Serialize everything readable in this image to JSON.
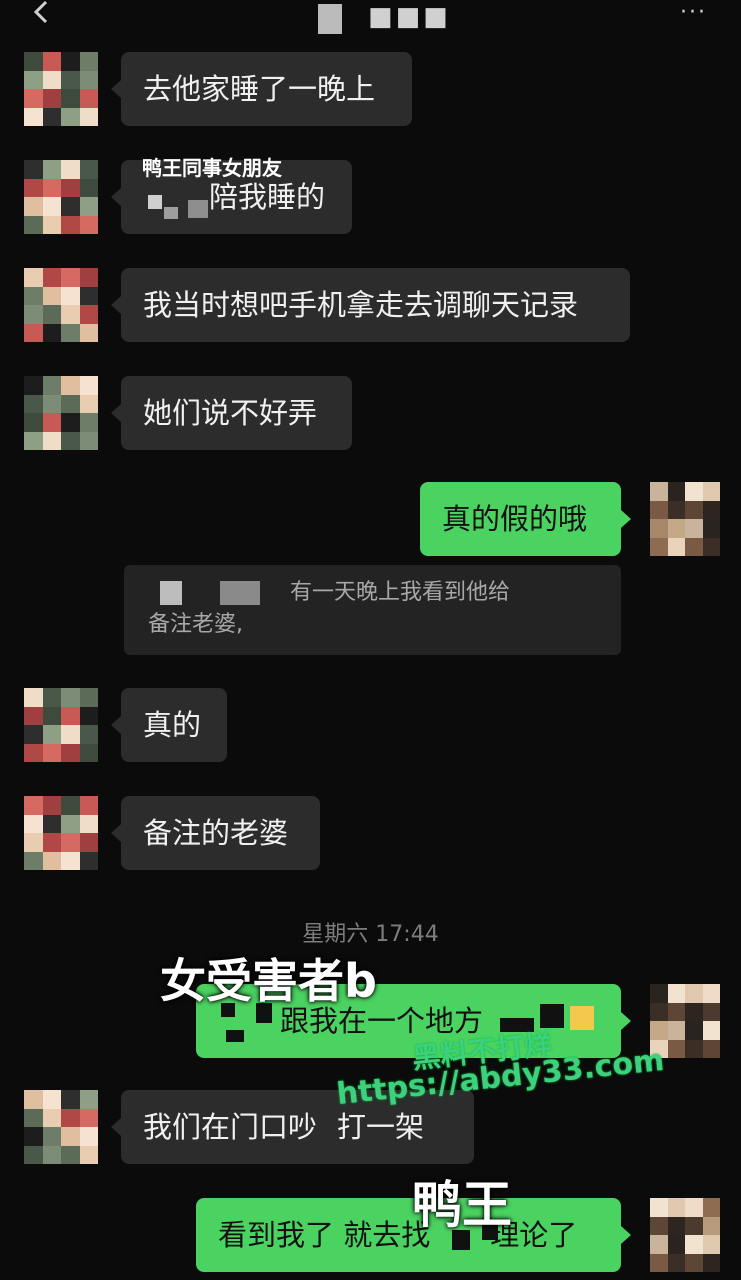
{
  "header": {
    "back_icon": "chevron-left-icon",
    "title_dots": "■■■",
    "more_icon": "···"
  },
  "messages": {
    "m1": "去他家睡了一晚上",
    "m2_sender": "鸭王同事女朋友",
    "m2_text": "陪我睡的",
    "m3": "我当时想吧手机拿走去调聊天记录",
    "m4": "她们说不好弄",
    "m5": "真的假的哦",
    "quote_line1": "有一天晚上我看到他给",
    "quote_line2": "备注老婆,",
    "m6": "真的",
    "m7": "备注的老婆",
    "timestamp": "星期六 17:44",
    "m8_text": "跟我在一个地方",
    "m9": "我们在门口吵",
    "m9_tail": "打一架",
    "m10_a": "看到我了 就去找",
    "m10_b": "理论了"
  },
  "overlays": {
    "victim_label": "女受害者b",
    "duck_label": "鸭王"
  },
  "watermark": {
    "line1": "黑料不打烊",
    "line2": "https://abdy33.com"
  },
  "colors": {
    "background": "#0b0b0b",
    "incoming_bubble": "#2c2c2c",
    "outgoing_bubble": "#4bd361",
    "watermark": "#3fd07f"
  }
}
